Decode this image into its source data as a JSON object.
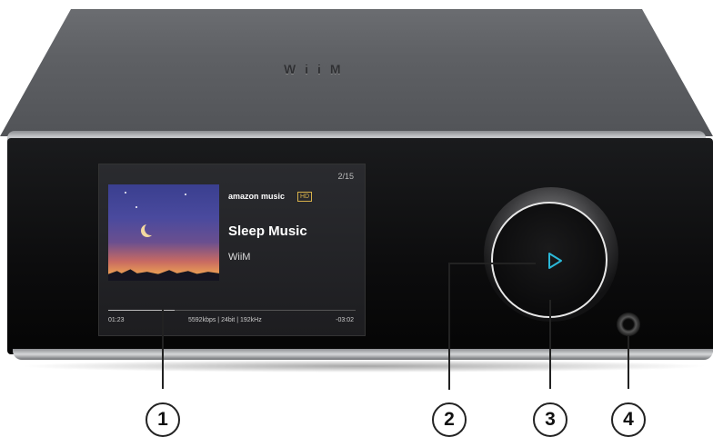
{
  "device": {
    "brand_logo": "WiiM"
  },
  "screen": {
    "track_count": "2/15",
    "service": "amazon music",
    "service_badge": "HD",
    "song_title": "Sleep Music",
    "artist": "WiiM",
    "elapsed": "01:23",
    "format": "5592kbps | 24bit | 192kHz",
    "remaining": "-03:02",
    "progress_fraction": 0.27
  },
  "callouts": [
    "1",
    "2",
    "3",
    "4"
  ],
  "icons": {
    "play": "play-icon",
    "accent_color": "#2bb8d8"
  }
}
